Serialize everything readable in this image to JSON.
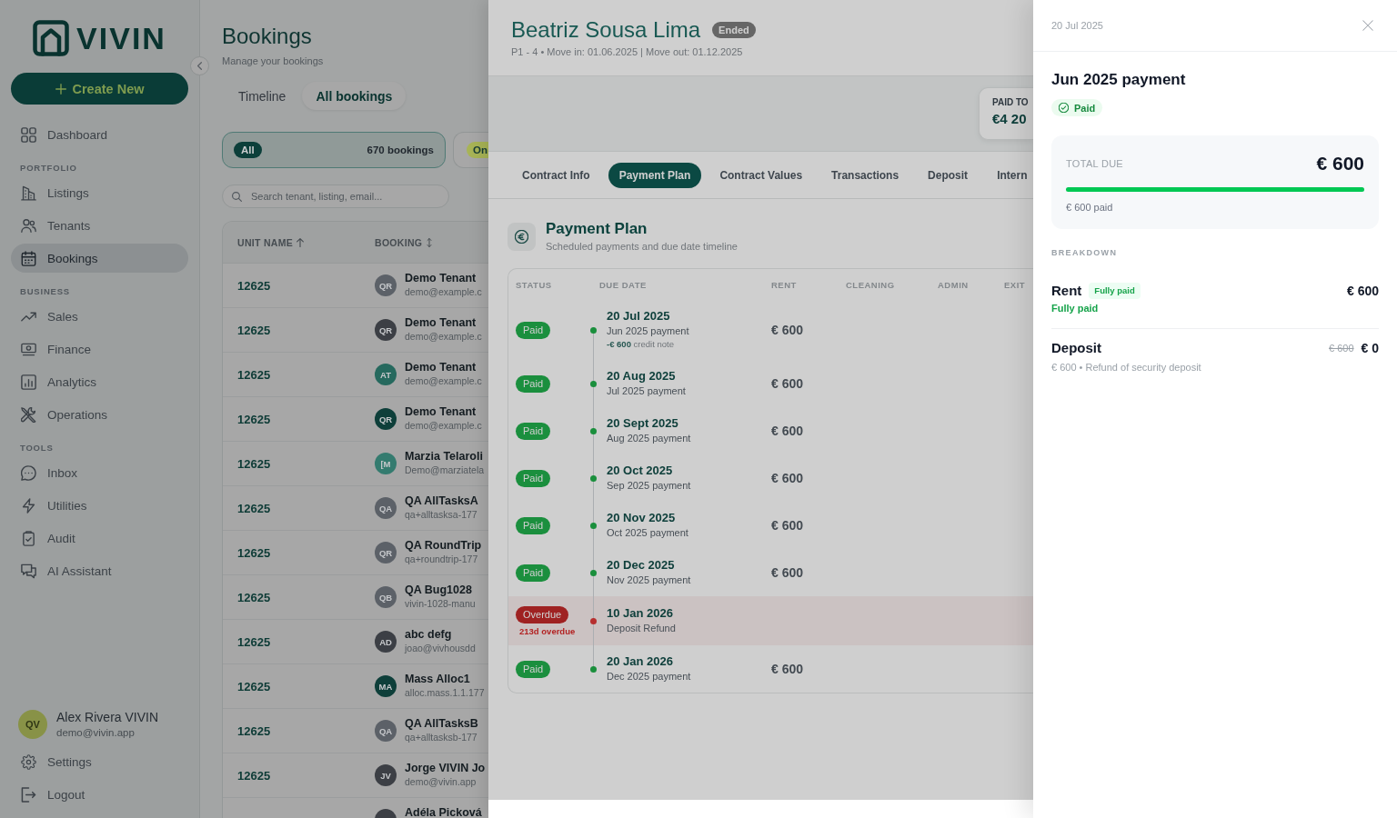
{
  "sidebar": {
    "logo_text": "VIVIN",
    "create_button": "Create New",
    "nav_groups": [
      {
        "items": [
          {
            "label": "Dashboard",
            "selected": false
          }
        ]
      },
      {
        "heading": "PORTFOLIO",
        "items": [
          {
            "label": "Listings",
            "selected": false
          },
          {
            "label": "Tenants",
            "selected": false
          },
          {
            "label": "Bookings",
            "selected": true
          }
        ]
      },
      {
        "heading": "BUSINESS",
        "items": [
          {
            "label": "Sales",
            "selected": false
          },
          {
            "label": "Finance",
            "selected": false
          },
          {
            "label": "Analytics",
            "selected": false
          },
          {
            "label": "Operations",
            "selected": false
          }
        ]
      },
      {
        "heading": "TOOLS",
        "items": [
          {
            "label": "Inbox",
            "selected": false
          },
          {
            "label": "Utilities",
            "selected": false
          },
          {
            "label": "Audit",
            "selected": false
          },
          {
            "label": "AI Assistant",
            "selected": false
          }
        ]
      }
    ],
    "user": {
      "initials": "QV",
      "name": "Alex Rivera VIVIN",
      "email": "demo@vivin.app"
    },
    "footer_links": [
      {
        "label": "Settings"
      },
      {
        "label": "Logout"
      }
    ]
  },
  "page": {
    "title": "Bookings",
    "subtitle": "Manage your bookings",
    "view_tabs": [
      {
        "label": "Timeline",
        "selected": false
      },
      {
        "label": "All bookings",
        "selected": true
      }
    ],
    "filter_chips": [
      {
        "label": "All",
        "count": "670 bookings",
        "color": "#0c3f3a",
        "selected": true
      },
      {
        "label": "On",
        "color": "#a8b456",
        "selected": false
      }
    ],
    "search": {
      "placeholder": "Search tenant, listing, email..."
    },
    "table": {
      "columns": [
        {
          "label": "UNIT NAME",
          "sorted": true
        },
        {
          "label": "BOOKING",
          "sorted": false
        }
      ],
      "rows": [
        {
          "unit": "12625",
          "initials": "QR",
          "color": "#5c6168",
          "name": "Demo Tenant",
          "email": "demo@example.c"
        },
        {
          "unit": "12625",
          "initials": "QR",
          "color": "#3c3f45",
          "name": "Demo Tenant",
          "email": "demo@example.c"
        },
        {
          "unit": "12625",
          "initials": "AT",
          "color": "#26695e",
          "name": "Demo Tenant",
          "email": "demo@example.c"
        },
        {
          "unit": "12625",
          "initials": "QR",
          "color": "#0e3f3a",
          "name": "Demo Tenant",
          "email": "demo@example.c"
        },
        {
          "unit": "12625",
          "initials": "[M",
          "color": "#347b6f",
          "name": "Marzia Telaroli",
          "email": "Demo@marziatela"
        },
        {
          "unit": "12625",
          "initials": "QA",
          "color": "#5c6168",
          "name": "QA AllTasksA",
          "email": "qa+alltasksa-177"
        },
        {
          "unit": "12625",
          "initials": "QR",
          "color": "#5c6168",
          "name": "QA RoundTrip",
          "email": "qa+roundtrip-177"
        },
        {
          "unit": "12625",
          "initials": "QB",
          "color": "#5c6168",
          "name": "QA Bug1028",
          "email": "vivin-1028-manu"
        },
        {
          "unit": "12625",
          "initials": "AD",
          "color": "#3c3f45",
          "name": "abc defg",
          "email": "joao@vivhousdd"
        },
        {
          "unit": "12625",
          "initials": "MA",
          "color": "#0e3f3a",
          "name": "Mass Alloc1",
          "email": "alloc.mass.1.1.177"
        },
        {
          "unit": "12625",
          "initials": "QA",
          "color": "#5c6168",
          "name": "QA AllTasksB",
          "email": "qa+alltasksb-177"
        },
        {
          "unit": "12625",
          "initials": "JV",
          "color": "#3c3f45",
          "name": "Jorge VIVIN Jo",
          "email": "demo@vivin.app"
        },
        {
          "color": "#3c3f45",
          "name": "Adéla Picková"
        }
      ]
    }
  },
  "booking_drawer": {
    "name": "Beatriz Sousa Lima",
    "status_badge": "Ended",
    "subtitle": "P1 - 4 • Move in: 01.06.2025 | Move out: 01.12.2025",
    "stats": [
      {
        "label": "PAID TO",
        "value": "€4 20"
      }
    ],
    "tabs": [
      {
        "label": "Contract Info",
        "selected": false
      },
      {
        "label": "Payment Plan",
        "selected": true
      },
      {
        "label": "Contract Values",
        "selected": false
      },
      {
        "label": "Transactions",
        "selected": false
      },
      {
        "label": "Deposit",
        "selected": false
      },
      {
        "label": "Intern",
        "selected": false
      }
    ],
    "section": {
      "title": "Payment Plan",
      "subtitle": "Scheduled payments and due date timeline"
    },
    "payments": {
      "columns": [
        "STATUS",
        "DUE DATE",
        "RENT",
        "CLEANING",
        "ADMIN",
        "EXIT"
      ],
      "rows": [
        {
          "overdue": false,
          "status_label": "Paid",
          "due_date": "20 Jul 2025",
          "description": "Jun 2025 payment",
          "note": "**-€ 600** credit note",
          "rent": "€ 600"
        },
        {
          "overdue": false,
          "status_label": "Paid",
          "due_date": "20 Aug 2025",
          "description": "Jul 2025 payment",
          "rent": "€ 600"
        },
        {
          "overdue": false,
          "status_label": "Paid",
          "due_date": "20 Sept 2025",
          "description": "Aug 2025 payment",
          "rent": "€ 600"
        },
        {
          "overdue": false,
          "status_label": "Paid",
          "due_date": "20 Oct 2025",
          "description": "Sep 2025 payment",
          "rent": "€ 600"
        },
        {
          "overdue": false,
          "status_label": "Paid",
          "due_date": "20 Nov 2025",
          "description": "Oct 2025 payment",
          "rent": "€ 600"
        },
        {
          "overdue": false,
          "status_label": "Paid",
          "due_date": "20 Dec 2025",
          "description": "Nov 2025 payment",
          "rent": "€ 600"
        },
        {
          "overdue": true,
          "status_label": "Overdue",
          "overdue_text": "213d overdue",
          "due_date": "10 Jan 2026",
          "description": "Deposit Refund"
        },
        {
          "overdue": false,
          "status_label": "Paid",
          "due_date": "20 Jan 2026",
          "description": "Dec 2025 payment",
          "rent": "€ 600"
        }
      ]
    }
  },
  "payment_panel": {
    "date": "20 Jul 2025",
    "title": "Jun 2025 payment",
    "paid": true,
    "status_label": "Paid",
    "total": {
      "label": "TOTAL DUE",
      "amount": "€ 600",
      "level": 1,
      "paid_text": "€ 600 paid"
    },
    "breakdown_heading": "BREAKDOWN",
    "breakdown": [
      {
        "label": "Rent",
        "tag": "Fully paid",
        "status_note": "Fully paid",
        "amount": "€ 600"
      },
      {
        "label": "Deposit",
        "description": "€ 600 • Refund of security deposit",
        "original_amount": "€ 600",
        "amount": "€ 0"
      }
    ]
  }
}
